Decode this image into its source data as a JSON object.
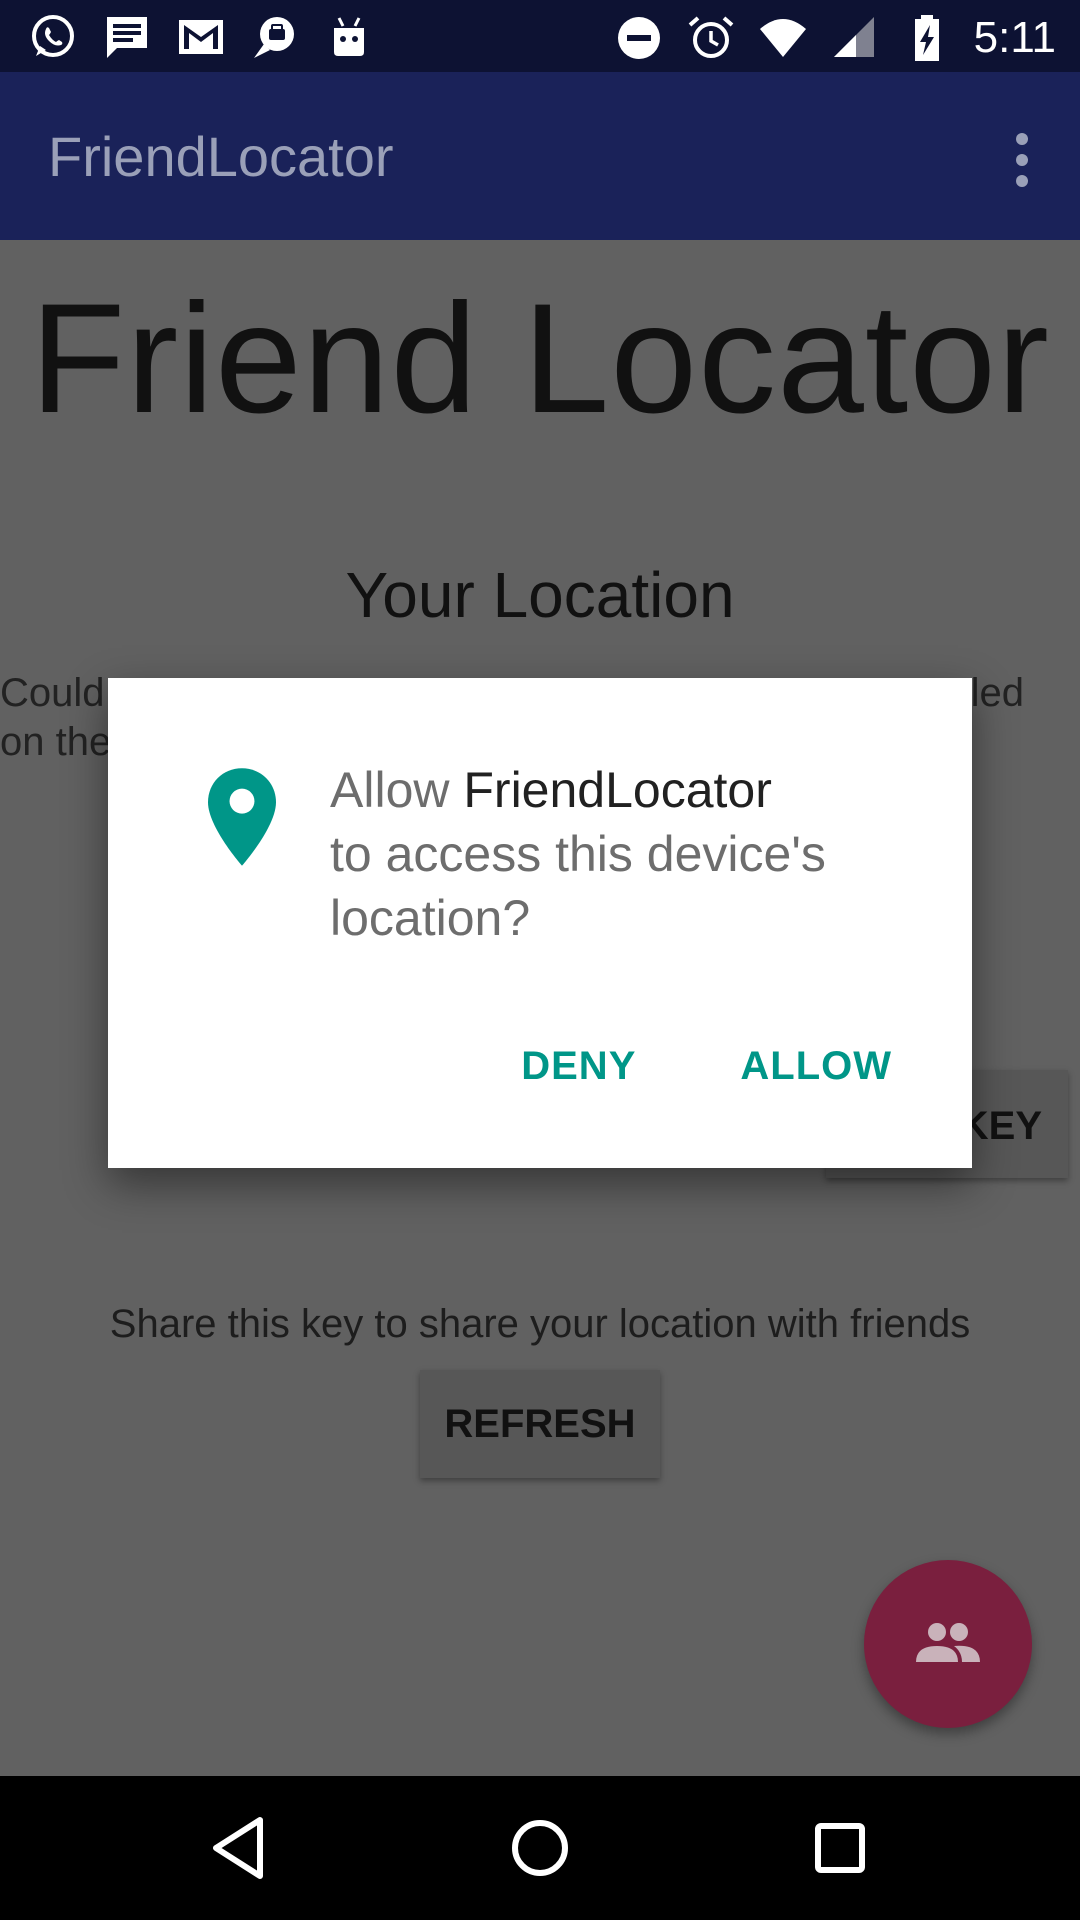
{
  "status_bar": {
    "time": "5:11",
    "left_icons": [
      "whatsapp-icon",
      "messages-icon",
      "gmail-icon",
      "hangouts-icon",
      "android-debug-icon"
    ],
    "right_icons": [
      "do-not-disturb-icon",
      "alarm-icon",
      "wifi-icon",
      "signal-icon",
      "battery-charging-icon"
    ]
  },
  "app_bar": {
    "title": "FriendLocator",
    "overflow_icon": "more-vert-icon"
  },
  "main": {
    "heading": "Friend Locator",
    "subheading": "Your Location",
    "error_line1_start": "Could",
    "error_line1_end": "led",
    "error_line2_start": "on the",
    "key_button_visible_label": "KEY",
    "share_text": "Share this key to share your location with friends",
    "refresh_label": "REFRESH",
    "fab_icon": "people-icon"
  },
  "dialog": {
    "icon": "location-pin-icon",
    "prefix": "Allow ",
    "app_name": "FriendLocator",
    "message_rest": "to access this device's location?",
    "deny_label": "DENY",
    "allow_label": "ALLOW"
  },
  "colors": {
    "accent": "#009688",
    "app_bar": "#1a2259",
    "status_bar": "#0d1233",
    "fab": "#7a1f3e",
    "scrim_background": "#616161"
  },
  "nav_bar": {
    "icons": [
      "back-icon",
      "home-icon",
      "recents-icon"
    ]
  }
}
